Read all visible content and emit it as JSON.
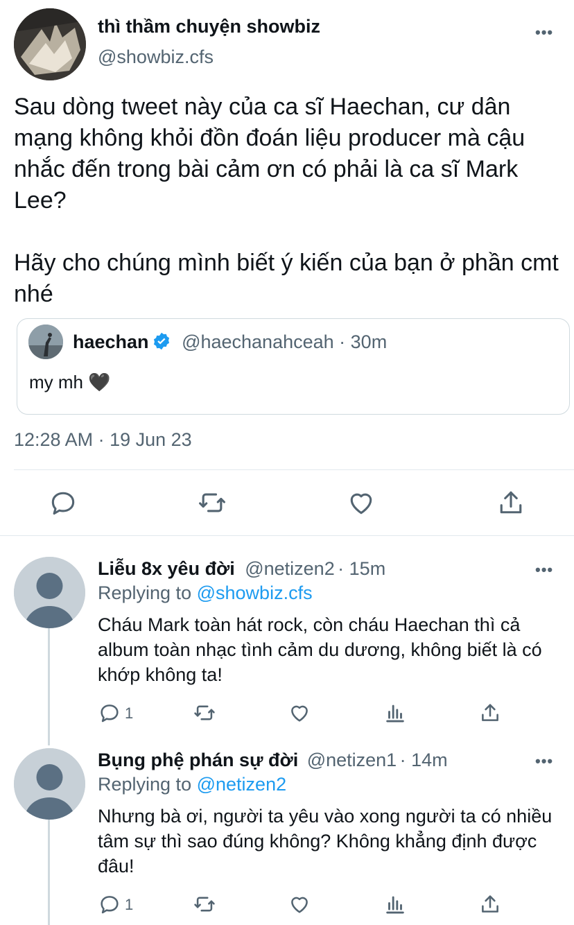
{
  "main_tweet": {
    "display_name": "thì thầm chuyện showbiz",
    "handle": "@showbiz.cfs",
    "text": "Sau dòng tweet này của ca sĩ Haechan, cư dân mạng không khỏi đồn đoán liệu producer mà cậu nhắc đến trong bài cảm ơn có phải là ca sĩ Mark Lee?\n\nHãy cho chúng mình biết ý kiến của bạn ở phần cmt nhé",
    "timestamp": "12:28 AM · 19 Jun 23",
    "quote": {
      "display_name": "haechan",
      "handle": "@haechanahceah",
      "time": "· 30m",
      "text": "my mh 🖤"
    }
  },
  "replies": [
    {
      "display_name": "Liễu 8x yêu đời",
      "handle": "@netizen2",
      "time": "· 15m",
      "replying_prefix": "Replying to",
      "replying_to": "@showbiz.cfs",
      "text": "Cháu Mark toàn hát rock, còn cháu Haechan thì cả album toàn nhạc tình cảm du dương, không biết là có khớp không ta!",
      "reply_count": "1"
    },
    {
      "display_name": "Bụng phệ phán sự đời",
      "handle": "@netizen1",
      "time": "· 14m",
      "replying_prefix": "Replying to",
      "replying_to": "@netizen2",
      "text": "Nhưng bà ơi, người ta yêu vào xong người ta có nhiều tâm sự thì sao đúng không? Không khẳng định được đâu!",
      "reply_count": "1"
    }
  ],
  "more_glyph": "•••",
  "colors": {
    "accent": "#1d9bf0",
    "muted": "#536471",
    "text": "#0f1419",
    "border": "#cfd9de"
  }
}
